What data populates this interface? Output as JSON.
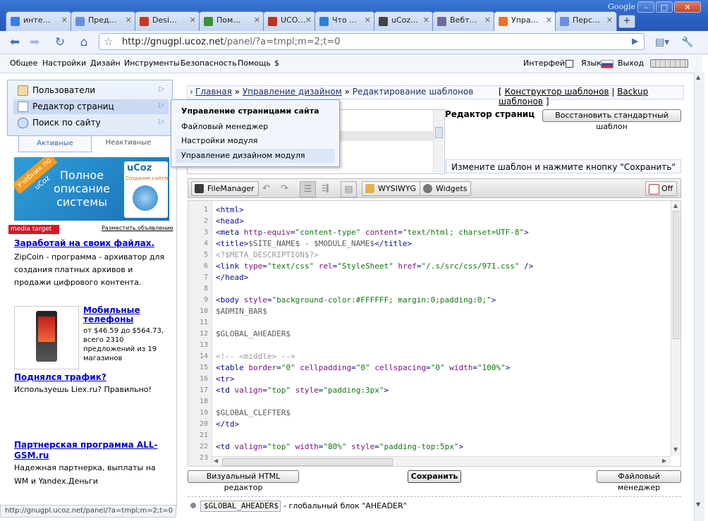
{
  "browser": {
    "brand": "Google",
    "tabs": [
      {
        "label": "инте…",
        "icon": "google-icon",
        "color": "#3b7de8"
      },
      {
        "label": "Пред…",
        "icon": "ucoz-icon",
        "color": "#6a8fd8"
      },
      {
        "label": "Desi…",
        "icon": "design-icon",
        "color": "#c0392b"
      },
      {
        "label": "Пом…",
        "icon": "globe-icon",
        "color": "#3d8f3d"
      },
      {
        "label": "UCO…",
        "icon": "ucoz-red-icon",
        "color": "#b8322a"
      },
      {
        "label": "Что …",
        "icon": "ie-icon",
        "color": "#2f7fd6"
      },
      {
        "label": "uCoz…",
        "icon": "wikipedia-icon",
        "color": "#444444"
      },
      {
        "label": "Вебт…",
        "icon": "webtutor-icon",
        "color": "#6b6b9a"
      },
      {
        "label": "Упра…",
        "icon": "ucoz-orange-icon",
        "color": "#e8702a"
      },
      {
        "label": "Перс…",
        "icon": "ucoz-icon",
        "color": "#6a8fd8"
      }
    ],
    "url_host": "http://gnugpl.ucoz.net",
    "url_path": "/panel/?a=tmpl;m=2;t=0",
    "status_url": "http://gnugpl.ucoz.net/panel/?a=tmpl;m=2;t=0"
  },
  "site_menu": {
    "items": [
      "Общее",
      "Настройки",
      "Дизайн",
      "Инструменты",
      "Безопасность",
      "Помощь",
      "$"
    ],
    "right": {
      "interface": "Интерфейс",
      "language": "Язык",
      "exit": "Выход"
    }
  },
  "left_panel": {
    "items": [
      {
        "label": "Пользователи",
        "icon": "user-icon"
      },
      {
        "label": "Редактор страниц",
        "icon": "page-icon"
      },
      {
        "label": "Поиск по сайту",
        "icon": "search-icon"
      }
    ],
    "tab_active": "Активные",
    "tab_inactive": "Неактивные"
  },
  "popup": {
    "title": "Управление страницами сайта",
    "items": [
      "Файловый менеджер",
      "Настройки модуля",
      "Управление дизайном модуля"
    ]
  },
  "ads": {
    "banner_ribbon": "Учебник по uCoz",
    "banner_text": "Полное описание системы",
    "banner_brand": "uCoz",
    "banner_sub": "Создание сайтов",
    "network": "media target",
    "place_ad": "Разместить объявление",
    "ad1_title": "Заработай на своих файлах.",
    "ad1_text": "ZipCoin - программа - архиватор для создания платных архивов и продажи цифрового контента.",
    "ad2_title": "Мобильные телефоны",
    "ad2_text": "от $46.59 до $564.73, всего 2310 предложений из 19 магазинов",
    "ad3_title": "Поднялся трафик?",
    "ad3_text": "Используешь Liex.ru? Правильно!",
    "ad4_title": "Партнерская программа ALL-GSM.ru",
    "ad4_text": "Надежная партнерка, выплаты на WM и Yandex.Деньги"
  },
  "breadcrumb": {
    "home": "Главная",
    "design": "Управление дизайном",
    "current": "Редактирование шаблонов",
    "link1": "Конструктор шаблонов",
    "link2": "Backup шаблонов"
  },
  "editor": {
    "title": "Редактор страниц",
    "restore_button": "Восстановить стандартный шаблон",
    "hint": "Измените шаблон и нажмите кнопку \"Сохранить\"",
    "toolbar": {
      "filemanager": "FileManager",
      "wysiwyg": "WYSIWYG",
      "widgets": "Widgets",
      "off": "Off"
    },
    "footer_left": "Визуальный HTML редактор",
    "save": "Сохранить",
    "footer_right": "Файловый менеджер",
    "var_name": "$GLOBAL_AHEADER$",
    "var_desc": "- глобальный блок \"AHEADER\""
  },
  "code_lines": [
    {
      "n": "1",
      "parts": [
        [
          "t",
          "<html>"
        ]
      ]
    },
    {
      "n": "2",
      "parts": [
        [
          "t",
          "<head>"
        ]
      ]
    },
    {
      "n": "3",
      "parts": [
        [
          "t",
          "<meta "
        ],
        [
          "a",
          "http-equiv"
        ],
        [
          "t",
          "="
        ],
        [
          "v",
          "\"content-type\""
        ],
        [
          "t",
          " "
        ],
        [
          "a",
          "content"
        ],
        [
          "t",
          "="
        ],
        [
          "v",
          "\"text/html; charset=UTF-8\""
        ],
        [
          "t",
          ">"
        ]
      ]
    },
    {
      "n": "4",
      "parts": [
        [
          "t",
          "<title>"
        ],
        [
          "c",
          "$SITE_NAME$ - $MODULE_NAME$"
        ],
        [
          "t",
          "</title>"
        ]
      ]
    },
    {
      "n": "5",
      "parts": [
        [
          "g",
          "<?$META_DESCRIPTION$?>"
        ]
      ]
    },
    {
      "n": "6",
      "parts": [
        [
          "t",
          "<link "
        ],
        [
          "a",
          "type"
        ],
        [
          "t",
          "="
        ],
        [
          "v",
          "\"text/css\""
        ],
        [
          "t",
          " "
        ],
        [
          "a",
          "rel"
        ],
        [
          "t",
          "="
        ],
        [
          "v",
          "\"StyleSheet\""
        ],
        [
          "t",
          " "
        ],
        [
          "a",
          "href"
        ],
        [
          "t",
          "="
        ],
        [
          "v",
          "\"/.s/src/css/971.css\""
        ],
        [
          "t",
          " />"
        ]
      ]
    },
    {
      "n": "7",
      "parts": [
        [
          "t",
          "</head>"
        ]
      ]
    },
    {
      "n": "8",
      "parts": []
    },
    {
      "n": "9",
      "parts": [
        [
          "t",
          "<body "
        ],
        [
          "a",
          "style"
        ],
        [
          "t",
          "="
        ],
        [
          "v",
          "\"background-color:#FFFFFF; margin:0;padding:0;\""
        ],
        [
          "t",
          ">"
        ]
      ]
    },
    {
      "n": "10",
      "parts": [
        [
          "c",
          "$ADMIN_BAR$"
        ]
      ]
    },
    {
      "n": "11",
      "parts": []
    },
    {
      "n": "12",
      "parts": [
        [
          "c",
          "$GLOBAL_AHEADER$"
        ]
      ]
    },
    {
      "n": "13",
      "parts": []
    },
    {
      "n": "14",
      "parts": [
        [
          "g",
          "<!-- <middle> -->"
        ]
      ]
    },
    {
      "n": "15",
      "parts": [
        [
          "t",
          "<table "
        ],
        [
          "a",
          "border"
        ],
        [
          "t",
          "="
        ],
        [
          "v",
          "\"0\""
        ],
        [
          "t",
          " "
        ],
        [
          "a",
          "cellpadding"
        ],
        [
          "t",
          "="
        ],
        [
          "v",
          "\"0\""
        ],
        [
          "t",
          " "
        ],
        [
          "a",
          "cellspacing"
        ],
        [
          "t",
          "="
        ],
        [
          "v",
          "\"0\""
        ],
        [
          "t",
          " "
        ],
        [
          "a",
          "width"
        ],
        [
          "t",
          "="
        ],
        [
          "v",
          "\"100%\""
        ],
        [
          "t",
          ">"
        ]
      ]
    },
    {
      "n": "16",
      "parts": [
        [
          "t",
          "<tr>"
        ]
      ]
    },
    {
      "n": "17",
      "parts": [
        [
          "t",
          "<td "
        ],
        [
          "a",
          "valign"
        ],
        [
          "t",
          "="
        ],
        [
          "v",
          "\"top\""
        ],
        [
          "t",
          " "
        ],
        [
          "a",
          "style"
        ],
        [
          "t",
          "="
        ],
        [
          "v",
          "\"padding:3px\""
        ],
        [
          "t",
          ">"
        ]
      ]
    },
    {
      "n": "18",
      "parts": []
    },
    {
      "n": "19",
      "parts": [
        [
          "c",
          "$GLOBAL_CLEFTER$"
        ]
      ]
    },
    {
      "n": "20",
      "parts": [
        [
          "t",
          "</td>"
        ]
      ]
    },
    {
      "n": "21",
      "parts": []
    },
    {
      "n": "22",
      "parts": [
        [
          "t",
          "<td "
        ],
        [
          "a",
          "valign"
        ],
        [
          "t",
          "="
        ],
        [
          "v",
          "\"top\""
        ],
        [
          "t",
          " "
        ],
        [
          "a",
          "width"
        ],
        [
          "t",
          "="
        ],
        [
          "v",
          "\"80%\""
        ],
        [
          "t",
          " "
        ],
        [
          "a",
          "style"
        ],
        [
          "t",
          "="
        ],
        [
          "v",
          "\"padding-top:5px\""
        ],
        [
          "t",
          ">"
        ]
      ]
    },
    {
      "n": "23",
      "parts": []
    }
  ]
}
